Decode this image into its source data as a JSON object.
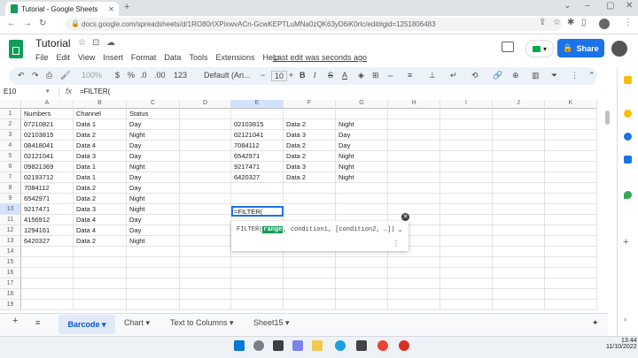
{
  "browser": {
    "tab_title": "Tutorial - Google Sheets",
    "new_tab": "+",
    "url": "docs.google.com/spreadsheets/d/1RO80rIXPixwvACn-GcwKEPTLuMNa0zQK63yD6iK0rlc/edit#gid=1251806483"
  },
  "doc": {
    "title": "Tutorial",
    "menu": [
      "File",
      "Edit",
      "View",
      "Insert",
      "Format",
      "Data",
      "Tools",
      "Extensions",
      "Help"
    ],
    "last_edit": "Last edit was seconds ago",
    "share_label": "Share"
  },
  "toolbar": {
    "zoom": "100%",
    "currency": "$",
    "percent": "%",
    "decimal_less": ".0",
    "decimal_more": ".00",
    "number_format": "123",
    "font": "Default (Ari...",
    "font_size": "10",
    "bold": "B",
    "italic": "I",
    "strike": "S",
    "text_color": "A"
  },
  "formula_bar": {
    "name_box": "E10",
    "fx": "fx",
    "content": "=FILTER("
  },
  "grid": {
    "columns": [
      "A",
      "B",
      "C",
      "D",
      "E",
      "F",
      "G",
      "H",
      "I",
      "J",
      "K"
    ],
    "rows": [
      "1",
      "2",
      "3",
      "4",
      "5",
      "6",
      "7",
      "8",
      "9",
      "10",
      "11",
      "12",
      "13",
      "14",
      "15",
      "16",
      "17",
      "18",
      "19"
    ],
    "cells_abc": [
      [
        "Numbers",
        "Channel",
        "Status"
      ],
      [
        "07210821",
        "Data 1",
        "Day"
      ],
      [
        "02103815",
        "Data 2",
        "Night"
      ],
      [
        "08418041",
        "Data 4",
        "Day"
      ],
      [
        "02121041",
        "Data 3",
        "Day"
      ],
      [
        "09821369",
        "Data 1",
        "Night"
      ],
      [
        "02193712",
        "Data 1",
        "Day"
      ],
      [
        "7084112",
        "Data 2",
        "Day"
      ],
      [
        "6542971",
        "Data 2",
        "Night"
      ],
      [
        "9217471",
        "Data 3",
        "Night"
      ],
      [
        "4156912",
        "Data 4",
        "Day"
      ],
      [
        "1294161",
        "Data 4",
        "Day"
      ],
      [
        "6420327",
        "Data 2",
        "Night"
      ]
    ],
    "cells_efg": [
      [
        "02103815",
        "Data 2",
        "Night"
      ],
      [
        "02121041",
        "Data 3",
        "Day"
      ],
      [
        "7084112",
        "Data 2",
        "Day"
      ],
      [
        "6542971",
        "Data 2",
        "Night"
      ],
      [
        "9217471",
        "Data 3",
        "Night"
      ],
      [
        "6420327",
        "Data 2",
        "Night"
      ]
    ],
    "active_cell_value": "=FILTER("
  },
  "tooltip": {
    "fn_name": "FILTER(",
    "highlight_arg": "range",
    "rest": ", condition1, [condition2, …])"
  },
  "sheet_tabs": {
    "active": "Barcode",
    "others": [
      "Chart",
      "Text to Columns",
      "Sheet15"
    ]
  },
  "taskbar": {
    "time": "13:44",
    "date": "11/10/2022"
  },
  "colors": {
    "accent": "#1a73e8",
    "sheets_green": "#0f9d58"
  }
}
